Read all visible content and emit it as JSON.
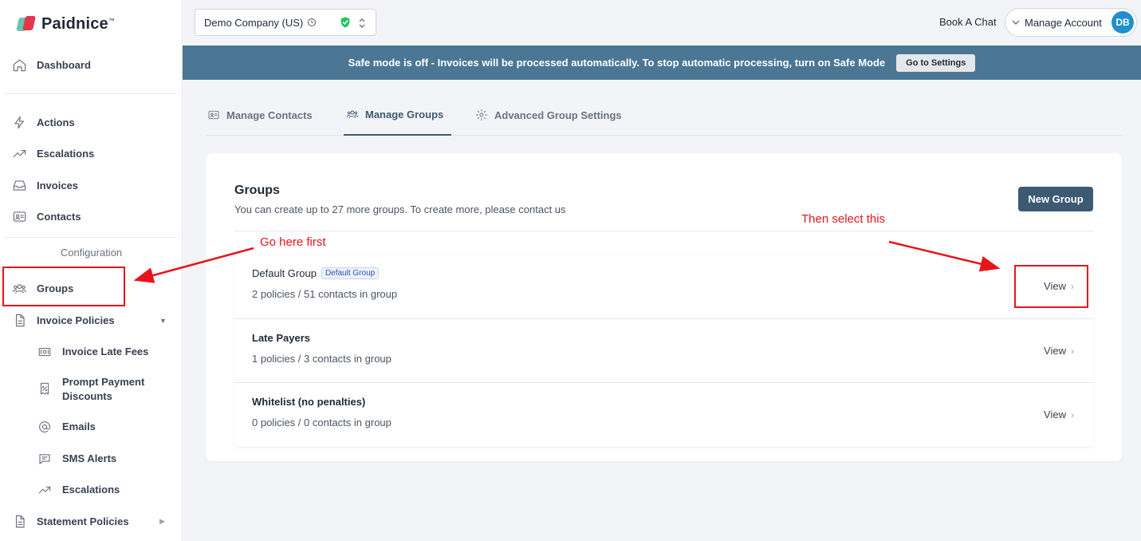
{
  "brand": {
    "name": "Paidnice",
    "tm": "™"
  },
  "sidebar": {
    "items": [
      {
        "label": "Dashboard",
        "icon": "home-icon"
      },
      {
        "label": "Actions",
        "icon": "lightning-icon"
      },
      {
        "label": "Escalations",
        "icon": "trending-up-icon"
      },
      {
        "label": "Invoices",
        "icon": "inbox-icon"
      },
      {
        "label": "Contacts",
        "icon": "id-card-icon"
      }
    ],
    "section_label": "Configuration",
    "config_items": [
      {
        "label": "Groups",
        "icon": "users-icon"
      },
      {
        "label": "Invoice Policies",
        "icon": "document-icon"
      }
    ],
    "sub_items": [
      {
        "label": "Invoice Late Fees",
        "icon": "cash-icon"
      },
      {
        "label": "Prompt Payment Discounts",
        "icon": "receipt-percent-icon"
      },
      {
        "label": "Emails",
        "icon": "at-icon"
      },
      {
        "label": "SMS Alerts",
        "icon": "chat-icon"
      },
      {
        "label": "Escalations",
        "icon": "trending-up-icon"
      }
    ],
    "statement": {
      "label": "Statement Policies",
      "icon": "document-icon"
    }
  },
  "header": {
    "company": "Demo Company (US)",
    "book_chat": "Book A Chat",
    "manage_account": "Manage Account",
    "avatar_initials": "DB"
  },
  "banner": {
    "text": "Safe mode is off - Invoices will be processed automatically. To stop automatic processing, turn on Safe Mode",
    "button": "Go to Settings"
  },
  "tabs": [
    {
      "label": "Manage Contacts",
      "icon": "id-card-icon",
      "active": false
    },
    {
      "label": "Manage Groups",
      "icon": "users-icon",
      "active": true
    },
    {
      "label": "Advanced Group Settings",
      "icon": "gear-icon",
      "active": false
    }
  ],
  "groups_card": {
    "title": "Groups",
    "subtitle": "You can create up to 27 more groups. To create more, please contact us",
    "new_button": "New Group",
    "rows": [
      {
        "name": "Default Group",
        "badge": "Default Group",
        "meta": "2 policies / 51 contacts in group",
        "action": "View"
      },
      {
        "name": "Late Payers",
        "meta": "1 policies / 3 contacts in group",
        "action": "View"
      },
      {
        "name": "Whitelist (no penalties)",
        "meta": "0 policies / 0 contacts in group",
        "action": "View"
      }
    ]
  },
  "annotations": {
    "first": "Go here first",
    "second": "Then select this",
    "color": "#e8141b"
  }
}
